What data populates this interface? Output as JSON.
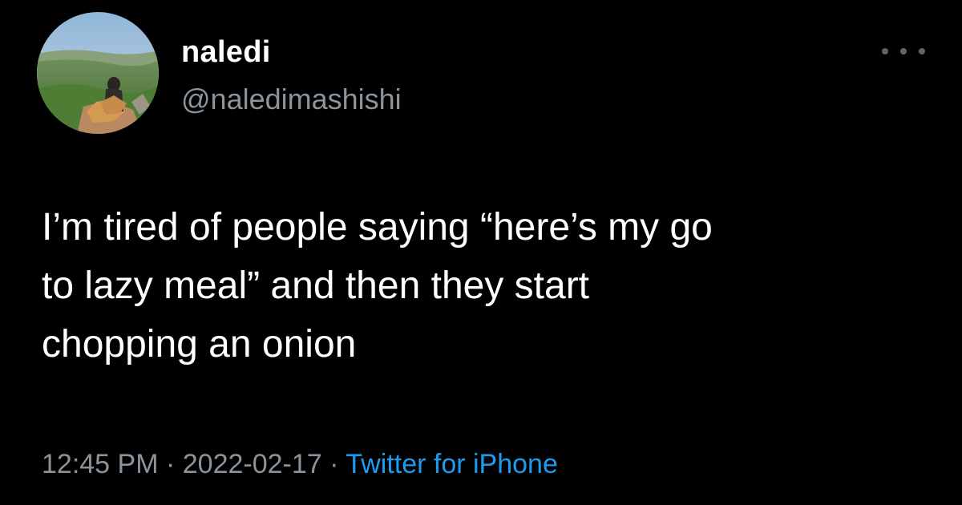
{
  "tweet": {
    "author": {
      "display_name": "naledi",
      "handle": "@naledimashishi",
      "avatar_icon": "profile-photo-person-on-hilltop"
    },
    "more_icon": "more-horizontal-icon",
    "text": "I’m tired of people saying “here’s my go\nto lazy meal” and then they start\nchopping an onion",
    "time": "12:45 PM",
    "separator": "·",
    "date": "2022-02-17",
    "source": "Twitter for iPhone"
  },
  "colors": {
    "background": "#000000",
    "text": "#ffffff",
    "secondary_text": "#8b949b",
    "link": "#1d9bf0"
  }
}
